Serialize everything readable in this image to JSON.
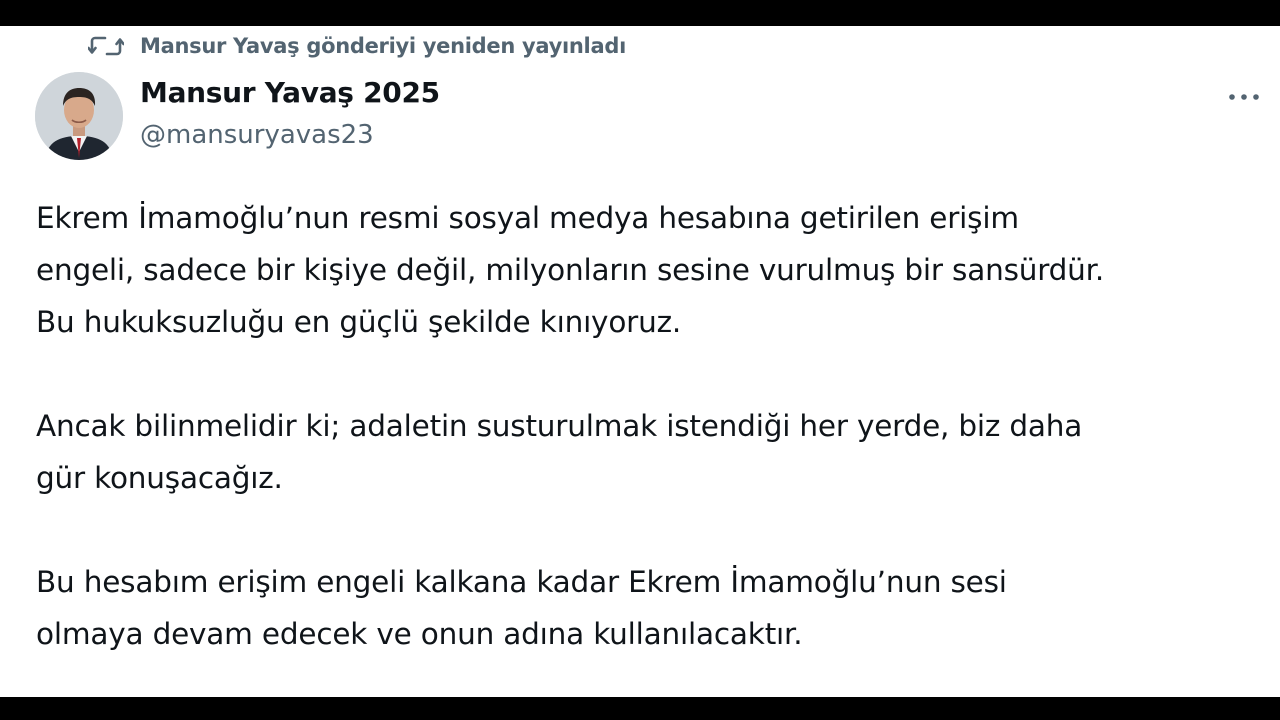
{
  "retweet": {
    "icon": "retweet-icon",
    "text": "Mansur Yavaş gönderiyi yeniden yayınladı"
  },
  "author": {
    "display_name": "Mansur Yavaş 2025",
    "handle": "@mansuryavas23",
    "avatar": "avatar-photo"
  },
  "menu": {
    "icon": "more-icon"
  },
  "post": {
    "lines": [
      "Ekrem İmamoğlu’nun resmi sosyal medya hesabına getirilen erişim",
      "engeli, sadece bir kişiye değil, milyonların sesine vurulmuş bir sansürdür.",
      "Bu hukuksuzluğu en güçlü şekilde kınıyoruz.",
      "Ancak bilinmelidir ki; adaletin susturulmak istendiği her yerde, biz daha",
      "gür konuşacağız.",
      "Bu hesabım erişim engeli kalkana kadar Ekrem İmamoğlu’nun sesi",
      "olmaya devam edecek ve onun adına kullanılacaktır."
    ]
  },
  "colors": {
    "text_primary": "#0f1419",
    "text_secondary": "#536471",
    "background": "#ffffff",
    "frame": "#000000"
  }
}
